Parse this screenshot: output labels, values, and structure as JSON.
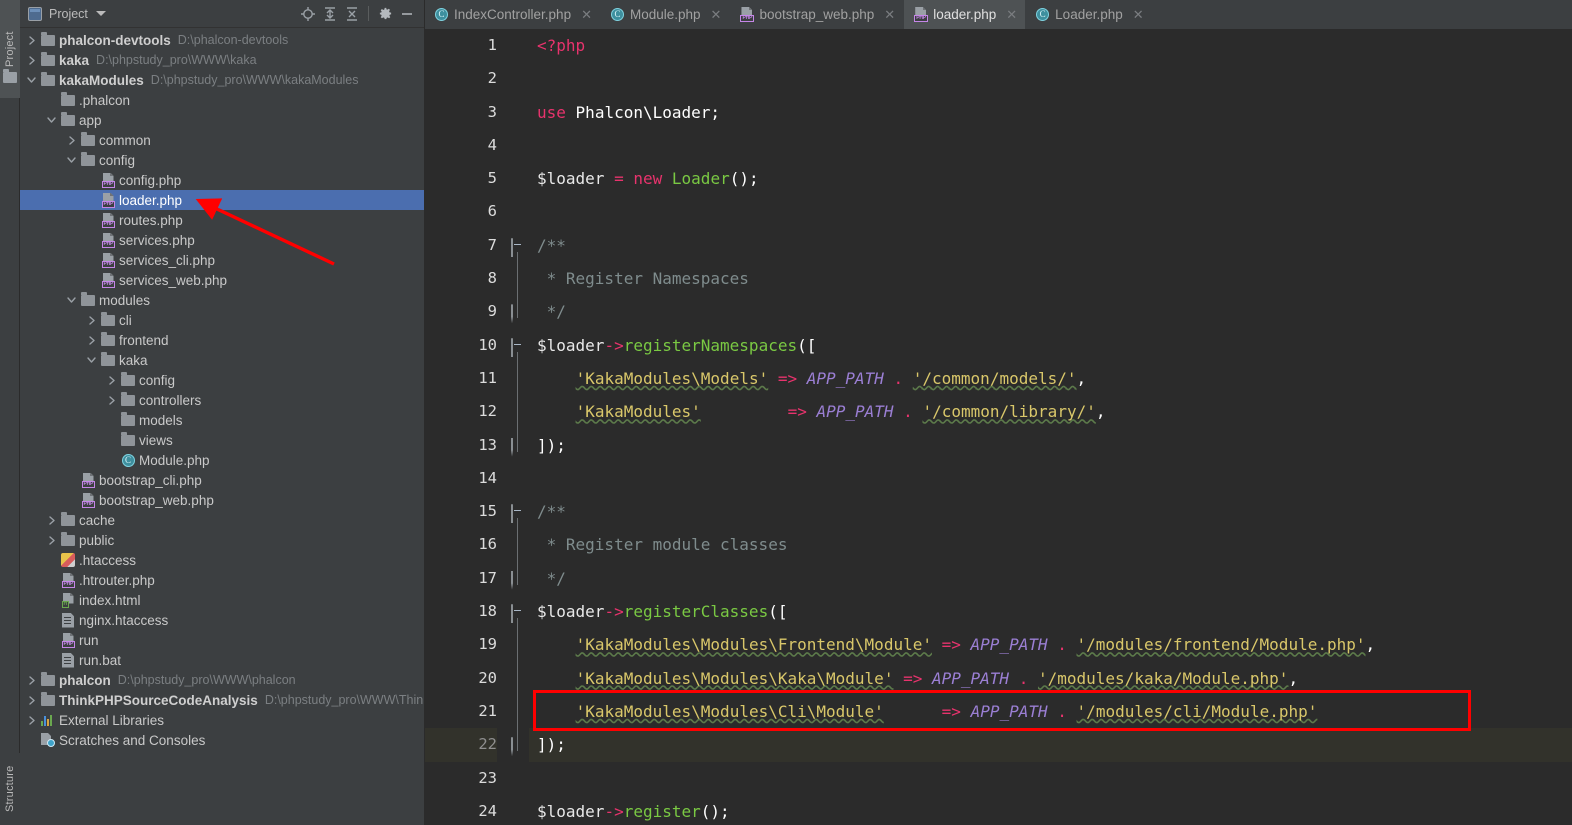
{
  "rail": {
    "top_label": "Project",
    "bottom_label": "Structure"
  },
  "panel": {
    "title": "Project",
    "icons": {
      "window": "project-window-icon",
      "caret": "chevron-down-icon",
      "locate": "locate-target-icon",
      "expand": "expand-all-icon",
      "collapse": "collapse-all-icon",
      "settings": "gear-icon",
      "hide": "minimize-icon"
    }
  },
  "tree": [
    {
      "indent": 0,
      "arrow": "right",
      "icon": "folder",
      "label": "phalcon-devtools",
      "bold": true,
      "path": "D:\\phalcon-devtools"
    },
    {
      "indent": 0,
      "arrow": "right",
      "icon": "folder",
      "label": "kaka",
      "bold": true,
      "path": "D:\\phpstudy_pro\\WWW\\kaka"
    },
    {
      "indent": 0,
      "arrow": "down",
      "icon": "folder",
      "label": "kakaModules",
      "bold": true,
      "path": "D:\\phpstudy_pro\\WWW\\kakaModules"
    },
    {
      "indent": 1,
      "arrow": "none",
      "icon": "folder",
      "label": ".phalcon",
      "bold": false,
      "path": ""
    },
    {
      "indent": 1,
      "arrow": "down",
      "icon": "folder",
      "label": "app",
      "bold": false,
      "path": ""
    },
    {
      "indent": 2,
      "arrow": "right",
      "icon": "folder",
      "label": "common",
      "bold": false,
      "path": ""
    },
    {
      "indent": 2,
      "arrow": "down",
      "icon": "folder",
      "label": "config",
      "bold": false,
      "path": ""
    },
    {
      "indent": 3,
      "arrow": "none",
      "icon": "php",
      "label": "config.php",
      "bold": false,
      "path": ""
    },
    {
      "indent": 3,
      "arrow": "none",
      "icon": "php",
      "label": "loader.php",
      "bold": false,
      "path": "",
      "selected": true
    },
    {
      "indent": 3,
      "arrow": "none",
      "icon": "php",
      "label": "routes.php",
      "bold": false,
      "path": ""
    },
    {
      "indent": 3,
      "arrow": "none",
      "icon": "php",
      "label": "services.php",
      "bold": false,
      "path": ""
    },
    {
      "indent": 3,
      "arrow": "none",
      "icon": "php",
      "label": "services_cli.php",
      "bold": false,
      "path": ""
    },
    {
      "indent": 3,
      "arrow": "none",
      "icon": "php",
      "label": "services_web.php",
      "bold": false,
      "path": ""
    },
    {
      "indent": 2,
      "arrow": "down",
      "icon": "folder",
      "label": "modules",
      "bold": false,
      "path": ""
    },
    {
      "indent": 3,
      "arrow": "right",
      "icon": "folder",
      "label": "cli",
      "bold": false,
      "path": ""
    },
    {
      "indent": 3,
      "arrow": "right",
      "icon": "folder",
      "label": "frontend",
      "bold": false,
      "path": ""
    },
    {
      "indent": 3,
      "arrow": "down",
      "icon": "folder",
      "label": "kaka",
      "bold": false,
      "path": ""
    },
    {
      "indent": 4,
      "arrow": "right",
      "icon": "folder",
      "label": "config",
      "bold": false,
      "path": ""
    },
    {
      "indent": 4,
      "arrow": "right",
      "icon": "folder",
      "label": "controllers",
      "bold": false,
      "path": ""
    },
    {
      "indent": 4,
      "arrow": "none",
      "icon": "folder",
      "label": "models",
      "bold": false,
      "path": ""
    },
    {
      "indent": 4,
      "arrow": "none",
      "icon": "folder",
      "label": "views",
      "bold": false,
      "path": ""
    },
    {
      "indent": 4,
      "arrow": "none",
      "icon": "class",
      "label": "Module.php",
      "bold": false,
      "path": ""
    },
    {
      "indent": 2,
      "arrow": "none",
      "icon": "php",
      "label": "bootstrap_cli.php",
      "bold": false,
      "path": ""
    },
    {
      "indent": 2,
      "arrow": "none",
      "icon": "php",
      "label": "bootstrap_web.php",
      "bold": false,
      "path": ""
    },
    {
      "indent": 1,
      "arrow": "right",
      "icon": "folder",
      "label": "cache",
      "bold": false,
      "path": ""
    },
    {
      "indent": 1,
      "arrow": "right",
      "icon": "folder",
      "label": "public",
      "bold": false,
      "path": ""
    },
    {
      "indent": 1,
      "arrow": "none",
      "icon": "htaccess",
      "label": ".htaccess",
      "bold": false,
      "path": ""
    },
    {
      "indent": 1,
      "arrow": "none",
      "icon": "php",
      "label": ".htrouter.php",
      "bold": false,
      "path": ""
    },
    {
      "indent": 1,
      "arrow": "none",
      "icon": "html",
      "label": "index.html",
      "bold": false,
      "path": ""
    },
    {
      "indent": 1,
      "arrow": "none",
      "icon": "txt",
      "label": "nginx.htaccess",
      "bold": false,
      "path": ""
    },
    {
      "indent": 1,
      "arrow": "none",
      "icon": "php",
      "label": "run",
      "bold": false,
      "path": ""
    },
    {
      "indent": 1,
      "arrow": "none",
      "icon": "txt",
      "label": "run.bat",
      "bold": false,
      "path": ""
    },
    {
      "indent": 0,
      "arrow": "right",
      "icon": "folder",
      "label": "phalcon",
      "bold": true,
      "path": "D:\\phpstudy_pro\\WWW\\phalcon"
    },
    {
      "indent": 0,
      "arrow": "right",
      "icon": "folder",
      "label": "ThinkPHPSourceCodeAnalysis",
      "bold": true,
      "path": "D:\\phpstudy_pro\\WWW\\ThinkP"
    },
    {
      "indent": 0,
      "arrow": "right",
      "icon": "libs",
      "label": "External Libraries",
      "bold": false,
      "path": ""
    },
    {
      "indent": 0,
      "arrow": "none",
      "icon": "scratch",
      "label": "Scratches and Consoles",
      "bold": false,
      "path": ""
    }
  ],
  "tabs": [
    {
      "label": "IndexController.php",
      "icon": "class-icon",
      "active": false
    },
    {
      "label": "Module.php",
      "icon": "class-icon",
      "active": false
    },
    {
      "label": "bootstrap_web.php",
      "icon": "php-icon",
      "active": false
    },
    {
      "label": "loader.php",
      "icon": "php-icon",
      "active": true
    },
    {
      "label": "Loader.php",
      "icon": "class-icon",
      "active": false
    }
  ],
  "editor": {
    "filename": "loader.php",
    "current_line": 22,
    "line_numbers": [
      "1",
      "2",
      "3",
      "4",
      "5",
      "6",
      "7",
      "8",
      "9",
      "10",
      "11",
      "12",
      "13",
      "14",
      "15",
      "16",
      "17",
      "18",
      "19",
      "20",
      "21",
      "22",
      "23",
      "24"
    ],
    "lines": [
      "<?php",
      "",
      "use Phalcon\\Loader;",
      "",
      "$loader = new Loader();",
      "",
      "/**",
      " * Register Namespaces",
      " */",
      "$loader->registerNamespaces([",
      "    'KakaModules\\Models' => APP_PATH . '/common/models/',",
      "    'KakaModules'         => APP_PATH . '/common/library/',",
      "]);",
      "",
      "/**",
      " * Register module classes",
      " */",
      "$loader->registerClasses([",
      "    'KakaModules\\Modules\\Frontend\\Module' => APP_PATH . '/modules/frontend/Module.php',",
      "    'KakaModules\\Modules\\Kaka\\Module' => APP_PATH . '/modules/kaka/Module.php',",
      "    'KakaModules\\Modules\\Cli\\Module'      => APP_PATH . '/modules/cli/Module.php'",
      "]);",
      "",
      "$loader->register();"
    ]
  },
  "annotations": {
    "highlight_box_line": 20,
    "highlight_box_color": "#ff0000",
    "arrow_color": "#ff0000",
    "arrow_target": "loader.php"
  },
  "colors": {
    "panel_bg": "#3c3f41",
    "editor_bg": "#2b2b2b",
    "selection": "#4b6eaf",
    "current_line": "#32322b",
    "keyword": "#e8336d",
    "string": "#d9c76a",
    "constant": "#9b7fd4",
    "method": "#7ac943",
    "comment": "#7f8c8d",
    "text": "#a9b7c6"
  }
}
